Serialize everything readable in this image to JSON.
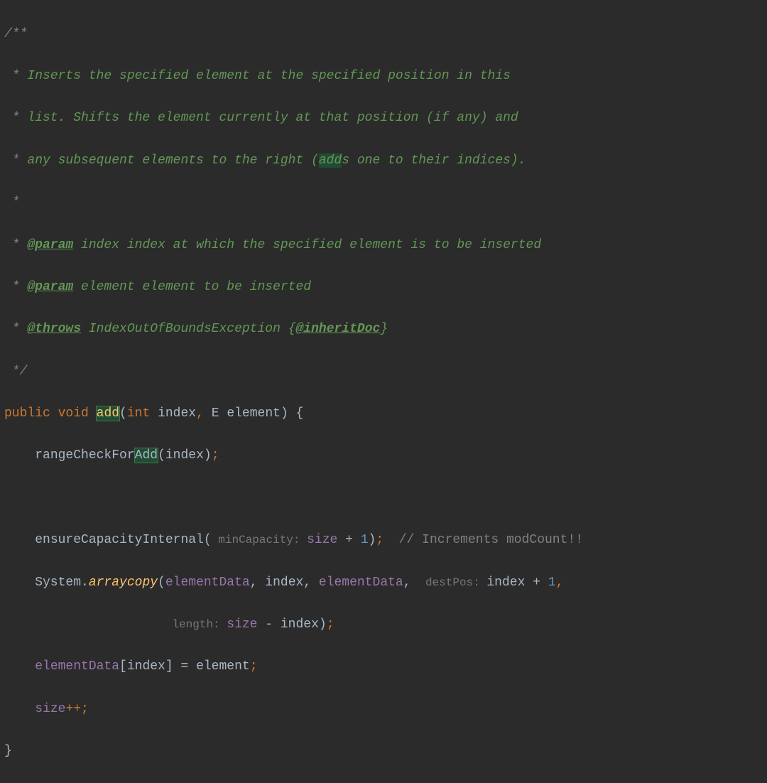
{
  "doc": {
    "openC": "/**",
    "star": " * ",
    "starE": " *",
    "closeC": " */",
    "l1a": "Inserts the specified element at the specified position in this",
    "l2a": "list. Shifts the element currently at that position (if any) and",
    "l3a": "any subsequent elements to the right (",
    "l3b": "add",
    "l3c": "s one to their indices).",
    "tagParam": "@param",
    "p1n": " index ",
    "p1d": "index at which the specified element is to be inserted",
    "p2n": " element ",
    "p2d": "element to be inserted",
    "tagThrows": "@throws",
    "th1sp": " ",
    "th1a": "IndexOutOfBoundsException {",
    "tagInherit": "@inheritDoc",
    "th1b": "}"
  },
  "sig": {
    "public": "public ",
    "void": "void ",
    "name": "add",
    "open": "(",
    "int": "int ",
    "arg1": "index",
    "comma": ", ",
    "E": "E ",
    "arg2": "element",
    "close": ") {"
  },
  "l_range": {
    "indent": "    ",
    "a": "rangeCheckFor",
    "b": "Add",
    "c": "(index)",
    "semi": ";"
  },
  "l_ensure": {
    "indent": "    ",
    "call": "ensureCapacityInternal(",
    "hint": " minCapacity: ",
    "field": "size ",
    "plus": "+ ",
    "one": "1",
    "close": ")",
    "semi": ";",
    "sp": "  ",
    "com": "// Increments modCount!!"
  },
  "l_arraycopy": {
    "indent": "    System.",
    "meth": "arraycopy",
    "open": "(",
    "ed1": "elementData",
    "c1": ", index, ",
    "ed2": "elementData",
    "c2": ", ",
    "hintDest": " destPos: ",
    "tail": "index + ",
    "one": "1",
    "comma3": ","
  },
  "l_arraycopy2": {
    "indent": "                     ",
    "hintLen": " length: ",
    "size": "size ",
    "rest": "- index)",
    "semi": ";"
  },
  "l_assign": {
    "indent": "    ",
    "ed": "elementData",
    "mid": "[index] = element",
    "semi": ";"
  },
  "l_inc": {
    "indent": "    ",
    "size": "size",
    "op": "++;"
  },
  "close": "}"
}
